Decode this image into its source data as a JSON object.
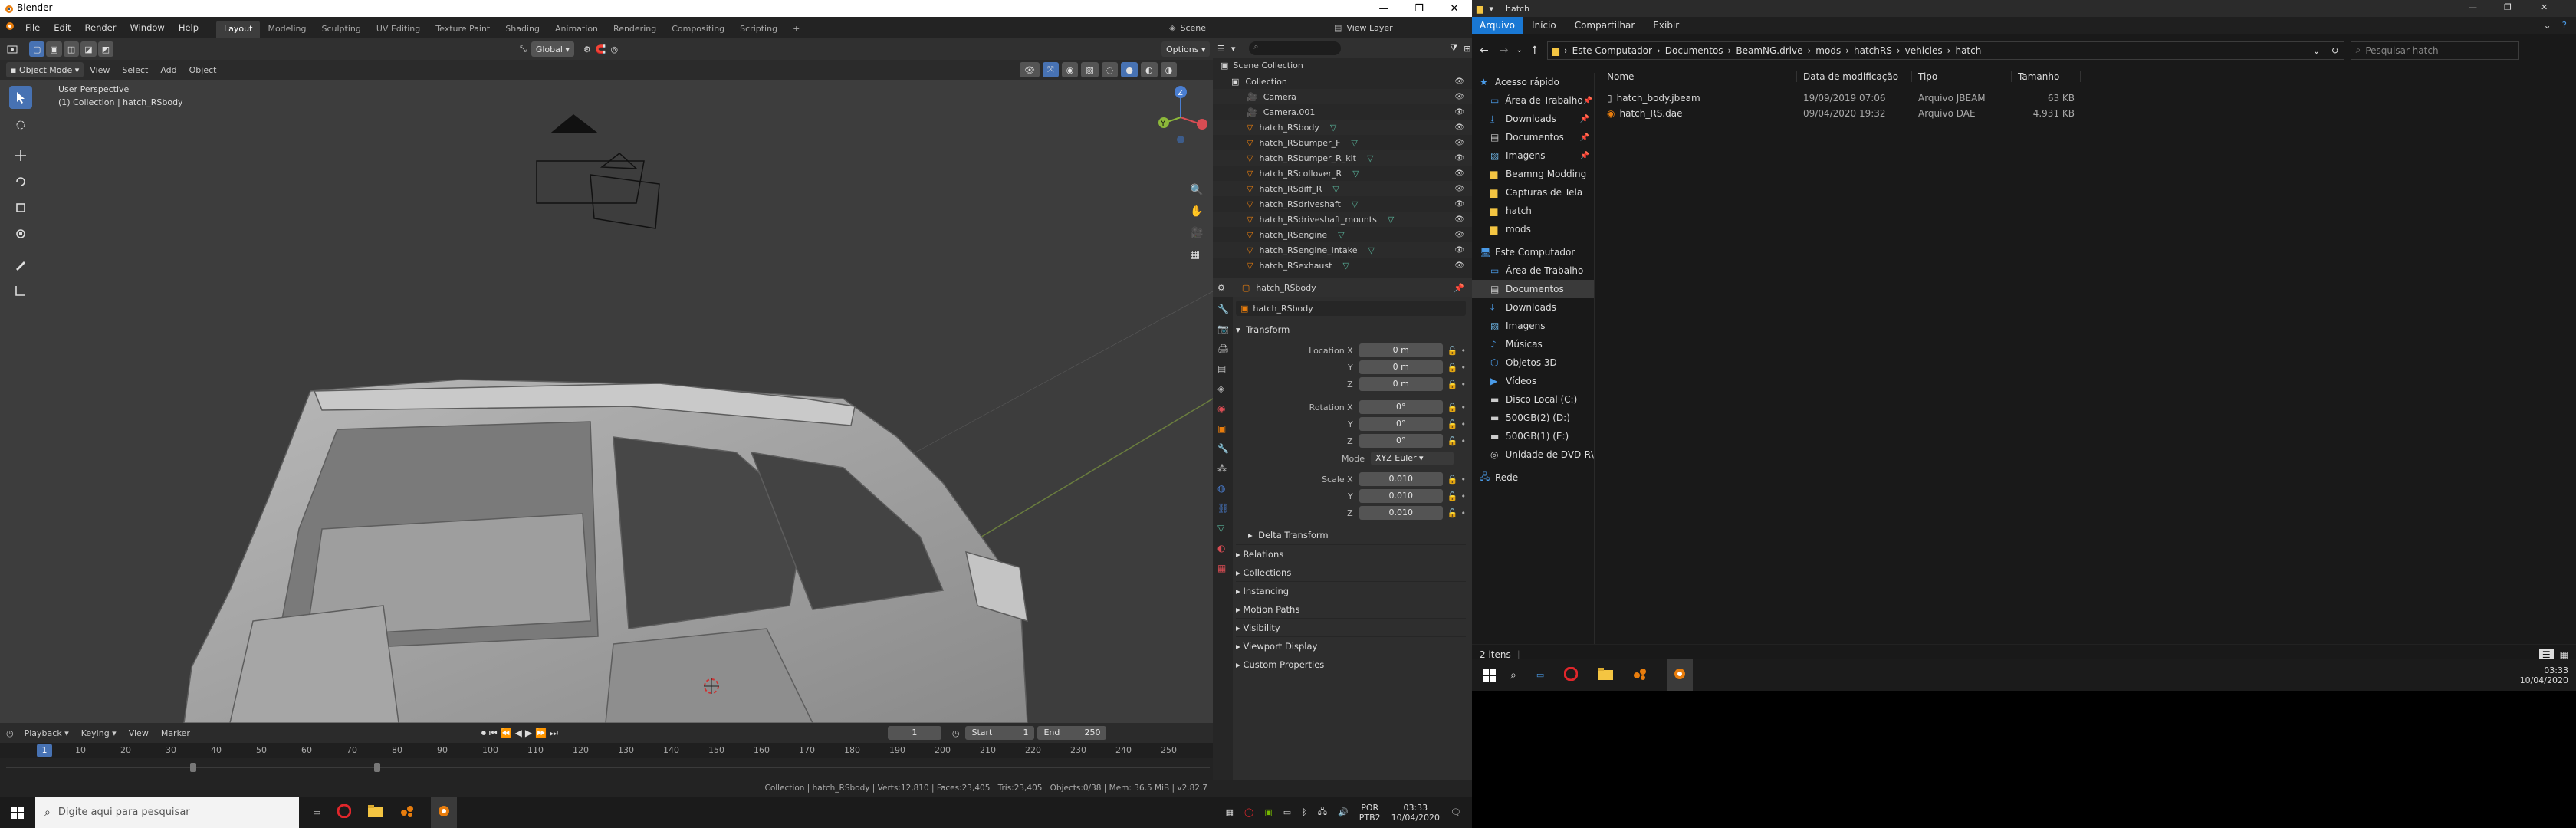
{
  "blender": {
    "window_title": "Blender",
    "menu": [
      "File",
      "Edit",
      "Render",
      "Window",
      "Help"
    ],
    "workspaces": [
      "Layout",
      "Modeling",
      "Sculpting",
      "UV Editing",
      "Texture Paint",
      "Shading",
      "Animation",
      "Rendering",
      "Compositing",
      "Scripting"
    ],
    "workspace_add": "+",
    "scene_label": "Scene",
    "view_layer_label": "View Layer",
    "viewport": {
      "mode": "Object Mode",
      "menus": [
        "View",
        "Select",
        "Add",
        "Object"
      ],
      "orientation": "Global",
      "options": "Options",
      "perspective": "User Perspective",
      "collection_info": "(1) Collection | hatch_RSbody"
    },
    "timeline": {
      "menus": [
        "Playback",
        "Keying",
        "View",
        "Marker"
      ],
      "current_frame": "1",
      "start_label": "Start",
      "start": "1",
      "end_label": "End",
      "end": "250",
      "ticks": [
        "10",
        "20",
        "30",
        "40",
        "50",
        "60",
        "70",
        "80",
        "90",
        "100",
        "110",
        "120",
        "130",
        "140",
        "150",
        "160",
        "170",
        "180",
        "190",
        "200",
        "210",
        "220",
        "230",
        "240",
        "250"
      ]
    },
    "outliner": {
      "root": "Scene Collection",
      "items": [
        {
          "name": "Collection",
          "icon": "collection-icon"
        },
        {
          "name": "Camera",
          "icon": "camera-icon"
        },
        {
          "name": "Camera.001",
          "icon": "camera-icon"
        },
        {
          "name": "hatch_RSbody",
          "icon": "mesh-icon"
        },
        {
          "name": "hatch_RSbumper_F",
          "icon": "mesh-icon"
        },
        {
          "name": "hatch_RSbumper_R_kit",
          "icon": "mesh-icon"
        },
        {
          "name": "hatch_RScollover_R",
          "icon": "mesh-icon"
        },
        {
          "name": "hatch_RSdiff_R",
          "icon": "mesh-icon"
        },
        {
          "name": "hatch_RSdriveshaft",
          "icon": "mesh-icon"
        },
        {
          "name": "hatch_RSdriveshaft_mounts",
          "icon": "mesh-icon"
        },
        {
          "name": "hatch_RSengine",
          "icon": "mesh-icon"
        },
        {
          "name": "hatch_RSengine_intake",
          "icon": "mesh-icon"
        },
        {
          "name": "hatch_RSexhaust",
          "icon": "mesh-icon"
        }
      ]
    },
    "properties": {
      "object_name": "hatch_RSbody",
      "object_field": "hatch_RSbody",
      "transform_title": "Transform",
      "location": {
        "label": "Location X",
        "x": "0 m",
        "y_label": "Y",
        "y": "0 m",
        "z_label": "Z",
        "z": "0 m"
      },
      "rotation": {
        "label": "Rotation X",
        "x": "0°",
        "y_label": "Y",
        "y": "0°",
        "z_label": "Z",
        "z": "0°"
      },
      "mode": {
        "label": "Mode",
        "value": "XYZ Euler"
      },
      "scale": {
        "label": "Scale X",
        "x": "0.010",
        "y_label": "Y",
        "y": "0.010",
        "z_label": "Z",
        "z": "0.010"
      },
      "delta": "Delta Transform",
      "panels": [
        "Relations",
        "Collections",
        "Instancing",
        "Motion Paths",
        "Visibility",
        "Viewport Display",
        "Custom Properties"
      ]
    },
    "statusbar": "Collection | hatch_RSbody | Verts:12,810 | Faces:23,405 | Tris:23,405 | Objects:0/38 | Mem: 36.5 MiB | v2.82.7"
  },
  "explorer": {
    "title": "hatch",
    "ribbon_tabs": [
      "Arquivo",
      "Início",
      "Compartilhar",
      "Exibir"
    ],
    "path": [
      "Este Computador",
      "Documentos",
      "BeamNG.drive",
      "mods",
      "hatchRS",
      "vehicles",
      "hatch"
    ],
    "search_placeholder": "Pesquisar hatch",
    "columns": [
      "Nome",
      "Data de modificação",
      "Tipo",
      "Tamanho"
    ],
    "files": [
      {
        "name": "hatch_body.jbeam",
        "date": "19/09/2019 07:06",
        "type": "Arquivo JBEAM",
        "size": "63 KB"
      },
      {
        "name": "hatch_RS.dae",
        "date": "09/04/2020 19:32",
        "type": "Arquivo DAE",
        "size": "4.931 KB"
      }
    ],
    "nav": [
      {
        "label": "Acesso rápido",
        "icon": "star-icon",
        "indent": 0
      },
      {
        "label": "Área de Trabalho",
        "icon": "desktop-icon",
        "indent": 1
      },
      {
        "label": "Downloads",
        "icon": "download-icon",
        "indent": 1
      },
      {
        "label": "Documentos",
        "icon": "document-icon",
        "indent": 1
      },
      {
        "label": "Imagens",
        "icon": "image-icon",
        "indent": 1
      },
      {
        "label": "Beamng Modding",
        "icon": "folder-icon",
        "indent": 1
      },
      {
        "label": "Capturas de Tela",
        "icon": "folder-icon",
        "indent": 1
      },
      {
        "label": "hatch",
        "icon": "folder-icon",
        "indent": 1
      },
      {
        "label": "mods",
        "icon": "folder-icon",
        "indent": 1
      },
      {
        "label": "Este Computador",
        "icon": "computer-icon",
        "indent": 0
      },
      {
        "label": "Área de Trabalho",
        "icon": "desktop-icon",
        "indent": 1
      },
      {
        "label": "Documentos",
        "icon": "document-icon",
        "indent": 1
      },
      {
        "label": "Downloads",
        "icon": "download-icon",
        "indent": 1
      },
      {
        "label": "Imagens",
        "icon": "image-icon",
        "indent": 1
      },
      {
        "label": "Músicas",
        "icon": "music-icon",
        "indent": 1
      },
      {
        "label": "Objetos 3D",
        "icon": "cube-icon",
        "indent": 1
      },
      {
        "label": "Vídeos",
        "icon": "video-icon",
        "indent": 1
      },
      {
        "label": "Disco Local (C:)",
        "icon": "drive-icon",
        "indent": 1
      },
      {
        "label": "500GB(2) (D:)",
        "icon": "drive-icon",
        "indent": 1
      },
      {
        "label": "500GB(1) (E:)",
        "icon": "drive-icon",
        "indent": 1
      },
      {
        "label": "Unidade de DVD-R\\",
        "icon": "dvd-icon",
        "indent": 1
      },
      {
        "label": "Rede",
        "icon": "network-icon",
        "indent": 0
      }
    ],
    "item_count": "2 itens"
  },
  "taskbar": {
    "search_placeholder": "Digite aqui para pesquisar",
    "lang": "POR",
    "layout": "PTB2",
    "time": "03:33",
    "date": "10/04/2020",
    "time2": "03:33",
    "date2": "10/04/2020"
  },
  "colors": {
    "accent": "#4772b3",
    "blender_orange": "#e87d0d",
    "mesh_green": "#59b59b",
    "folder_yellow": "#f4c542"
  }
}
